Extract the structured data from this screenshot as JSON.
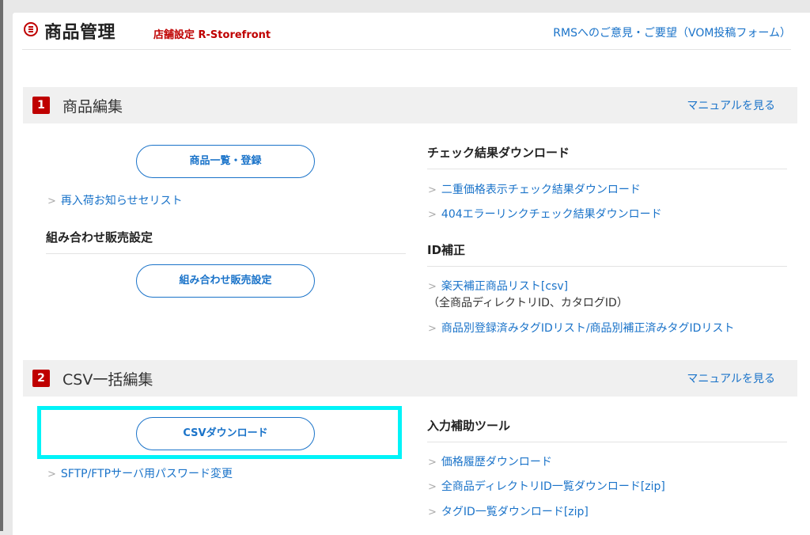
{
  "header": {
    "title": "商品管理",
    "store": "店舗設定 R-Storefront",
    "feedback_link": "RMSへのご意見・ご要望（VOM投稿フォーム）"
  },
  "section1": {
    "num": "1",
    "title": "商品編集",
    "manual": "マニュアルを見る",
    "left": {
      "button_list": "商品一覧・登録",
      "link_restock": "再入荷お知らせセリスト",
      "combo_heading": "組み合わせ販売設定",
      "button_combo": "組み合わせ販売設定"
    },
    "right": {
      "check_heading": "チェック結果ダウンロード",
      "check_links": [
        "二重価格表示チェック結果ダウンロード",
        "404エラーリンクチェック結果ダウンロード"
      ],
      "id_heading": "ID補正",
      "id_link1": "楽天補正商品リスト[csv]",
      "id_link1_note": "（全商品ディレクトリID、カタログID）",
      "id_link2": "商品別登録済みタグIDリスト/商品別補正済みタグIDリスト"
    }
  },
  "section2": {
    "num": "2",
    "title": "CSV一括編集",
    "manual": "マニュアルを見る",
    "left": {
      "button_csv": "CSVダウンロード",
      "link_sftp": "SFTP/FTPサーバ用パスワード変更"
    },
    "right": {
      "tools_heading": "入力補助ツール",
      "links": [
        "価格履歴ダウンロード",
        "全商品ディレクトリID一覧ダウンロード[zip]",
        "タグID一覧ダウンロード[zip]"
      ]
    }
  },
  "colors": {
    "brand_red": "#bf0000",
    "link_blue": "#1a73c9",
    "highlight": "#00f3f8"
  }
}
